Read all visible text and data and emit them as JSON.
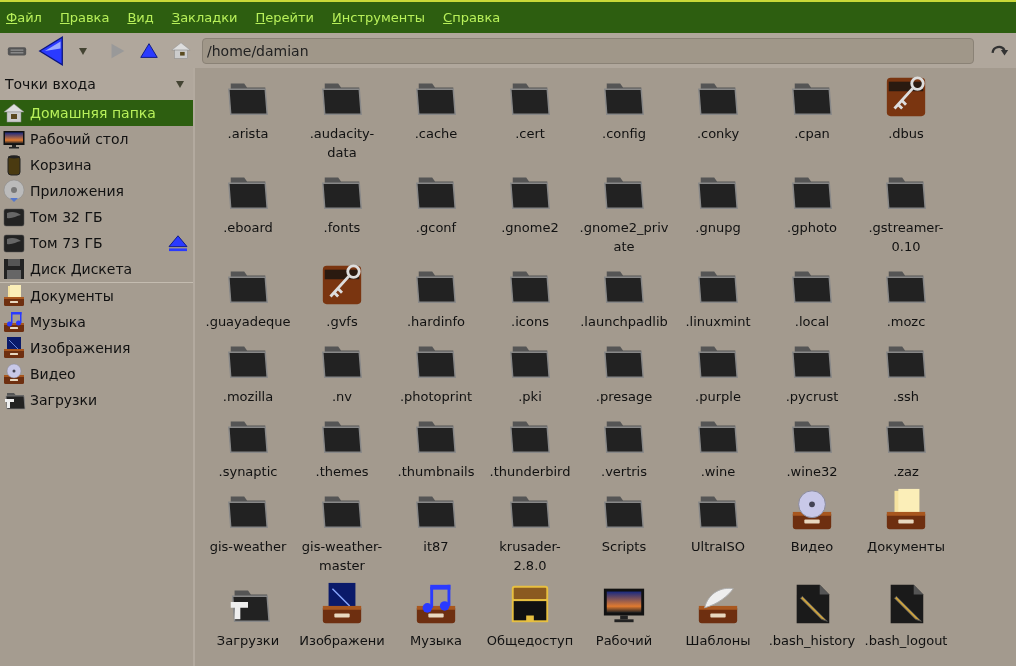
{
  "menu": [
    {
      "label": "Файл"
    },
    {
      "label": "Правка"
    },
    {
      "label": "Вид"
    },
    {
      "label": "Закладки"
    },
    {
      "label": "Перейти"
    },
    {
      "label": "Инструменты"
    },
    {
      "label": "Справка"
    }
  ],
  "location": {
    "value": "/home/damian"
  },
  "sidebar": {
    "title": "Точки входа",
    "groups": [
      [
        {
          "label": "Домашняя папка",
          "kind": "home",
          "selected": true,
          "eject": false
        },
        {
          "label": "Рабочий стол",
          "kind": "desktop",
          "selected": false,
          "eject": false
        },
        {
          "label": "Корзина",
          "kind": "trash",
          "selected": false,
          "eject": false
        },
        {
          "label": "Приложения",
          "kind": "disc",
          "selected": false,
          "eject": false
        },
        {
          "label": "Том 32 ГБ",
          "kind": "drive",
          "selected": false,
          "eject": false
        },
        {
          "label": "Том 73 ГБ",
          "kind": "drive",
          "selected": false,
          "eject": true
        },
        {
          "label": "Диск Дискета",
          "kind": "floppy",
          "selected": false,
          "eject": false
        }
      ],
      [
        {
          "label": "Документы",
          "kind": "docs",
          "selected": false,
          "eject": false
        },
        {
          "label": "Музыка",
          "kind": "music",
          "selected": false,
          "eject": false
        },
        {
          "label": "Изображения",
          "kind": "images",
          "selected": false,
          "eject": false
        },
        {
          "label": "Видео",
          "kind": "video",
          "selected": false,
          "eject": false
        },
        {
          "label": "Загрузки",
          "kind": "downloads",
          "selected": false,
          "eject": false
        }
      ]
    ]
  },
  "items": [
    {
      "label": ".arista",
      "kind": "folder"
    },
    {
      "label": ".audacity-data",
      "kind": "folder"
    },
    {
      "label": ".cache",
      "kind": "folder"
    },
    {
      "label": ".cert",
      "kind": "folder"
    },
    {
      "label": ".config",
      "kind": "folder"
    },
    {
      "label": ".conky",
      "kind": "folder"
    },
    {
      "label": ".cpan",
      "kind": "folder"
    },
    {
      "label": ".dbus",
      "kind": "key"
    },
    {
      "label": ".eboard",
      "kind": "folder"
    },
    {
      "label": ".fonts",
      "kind": "folder"
    },
    {
      "label": ".gconf",
      "kind": "folder"
    },
    {
      "label": ".gnome2",
      "kind": "folder"
    },
    {
      "label": ".gnome2_private",
      "kind": "folder"
    },
    {
      "label": ".gnupg",
      "kind": "folder"
    },
    {
      "label": ".gphoto",
      "kind": "folder"
    },
    {
      "label": ".gstreamer-0.10",
      "kind": "folder"
    },
    {
      "label": ".guayadeque",
      "kind": "folder"
    },
    {
      "label": ".gvfs",
      "kind": "key"
    },
    {
      "label": ".hardinfo",
      "kind": "folder"
    },
    {
      "label": ".icons",
      "kind": "folder"
    },
    {
      "label": ".launchpadlib",
      "kind": "folder"
    },
    {
      "label": ".linuxmint",
      "kind": "folder"
    },
    {
      "label": ".local",
      "kind": "folder"
    },
    {
      "label": ".mozc",
      "kind": "folder"
    },
    {
      "label": ".mozilla",
      "kind": "folder"
    },
    {
      "label": ".nv",
      "kind": "folder"
    },
    {
      "label": ".photoprint",
      "kind": "folder"
    },
    {
      "label": ".pki",
      "kind": "folder"
    },
    {
      "label": ".presage",
      "kind": "folder"
    },
    {
      "label": ".purple",
      "kind": "folder"
    },
    {
      "label": ".pycrust",
      "kind": "folder"
    },
    {
      "label": ".ssh",
      "kind": "folder"
    },
    {
      "label": ".synaptic",
      "kind": "folder"
    },
    {
      "label": ".themes",
      "kind": "folder"
    },
    {
      "label": ".thumbnails",
      "kind": "folder"
    },
    {
      "label": ".thunderbird",
      "kind": "folder"
    },
    {
      "label": ".vertris",
      "kind": "folder"
    },
    {
      "label": ".wine",
      "kind": "folder"
    },
    {
      "label": ".wine32",
      "kind": "folder"
    },
    {
      "label": ".zaz",
      "kind": "folder"
    },
    {
      "label": "gis-weather",
      "kind": "folder"
    },
    {
      "label": "gis-weather-master",
      "kind": "folder"
    },
    {
      "label": "it87",
      "kind": "folder"
    },
    {
      "label": "krusader-2.8.0",
      "kind": "folder"
    },
    {
      "label": "Scripts",
      "kind": "folder"
    },
    {
      "label": "UltraISO",
      "kind": "folder"
    },
    {
      "label": "Видео",
      "kind": "video"
    },
    {
      "label": "Документы",
      "kind": "docs"
    },
    {
      "label": "Загрузки",
      "kind": "downloads"
    },
    {
      "label": "Изображени",
      "kind": "images"
    },
    {
      "label": "Музыка",
      "kind": "music"
    },
    {
      "label": "Общедоступ",
      "kind": "chest"
    },
    {
      "label": "Рабочий",
      "kind": "desktop"
    },
    {
      "label": "Шаблоны",
      "kind": "templates"
    },
    {
      "label": ".bash_history",
      "kind": "textfile"
    },
    {
      "label": ".bash_logout",
      "kind": "textfile"
    }
  ]
}
